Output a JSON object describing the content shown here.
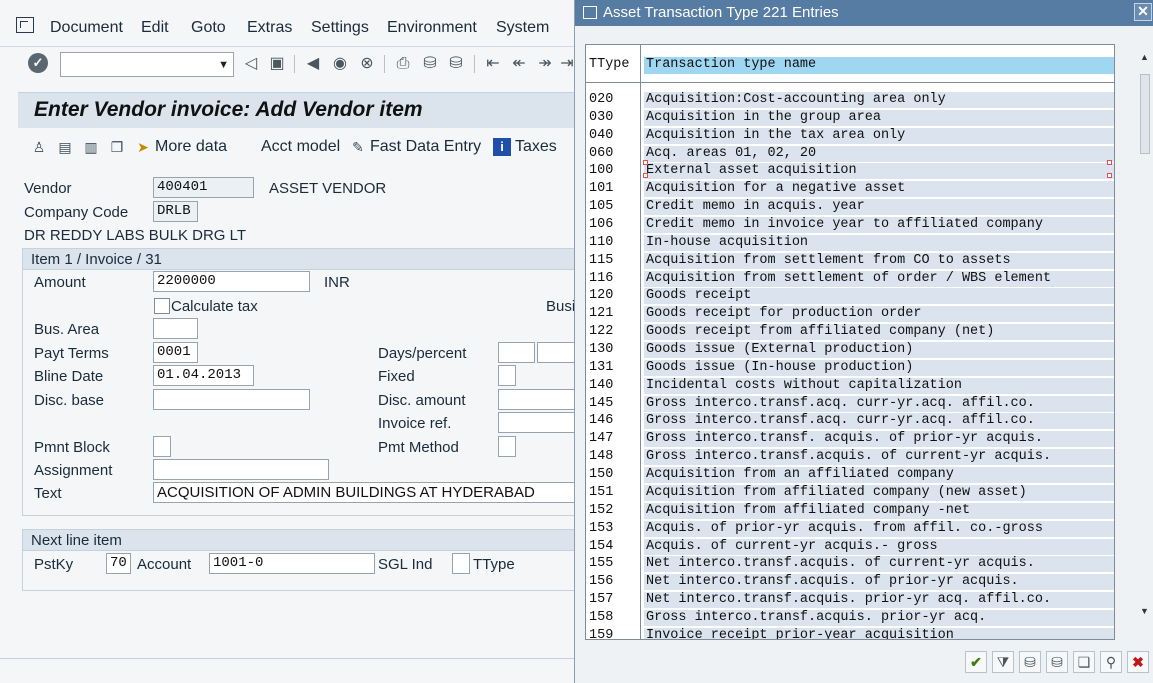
{
  "menu": {
    "items": [
      {
        "label": "Document"
      },
      {
        "label": "Edit"
      },
      {
        "label": "Goto"
      },
      {
        "label": "Extras"
      },
      {
        "label": "Settings"
      },
      {
        "label": "Environment"
      },
      {
        "label": "System"
      }
    ]
  },
  "screen": {
    "title": "Enter Vendor invoice: Add Vendor item"
  },
  "app_toolbar": {
    "more_data": "More data",
    "acct_model": "Acct model",
    "fast_data_entry": "Fast Data Entry",
    "taxes": "Taxes"
  },
  "header_fields": {
    "vendor_label": "Vendor",
    "vendor_value": "400401",
    "vendor_name": "ASSET VENDOR",
    "company_code_label": "Company Code",
    "company_code_value": "DRLB",
    "company_name": "DR REDDY LABS BULK DRG LT"
  },
  "item": {
    "group_title": "Item 1 / Invoice / 31",
    "amount_label": "Amount",
    "amount_value": "2200000",
    "currency": "INR",
    "calc_tax_label": "Calculate tax",
    "bus_cut": "Busi",
    "bus_area_label": "Bus. Area",
    "payt_terms_label": "Payt Terms",
    "payt_terms_value": "0001",
    "days_percent_label": "Days/percent",
    "bline_date_label": "Bline Date",
    "bline_date_value": "01.04.2013",
    "fixed_label": "Fixed",
    "disc_base_label": "Disc. base",
    "disc_amount_label": "Disc. amount",
    "invoice_ref_label": "Invoice ref.",
    "pmnt_block_label": "Pmnt Block",
    "pmt_method_label": "Pmt Method",
    "assignment_label": "Assignment",
    "text_label": "Text",
    "text_value": "ACQUISITION OF ADMIN BUILDINGS  AT HYDERABAD"
  },
  "next_line": {
    "group_title": "Next line item",
    "pstky_label": "PstKy",
    "pstky_value": "70",
    "account_label": "Account",
    "account_value": "1001-0",
    "sgl_ind_label": "SGL Ind",
    "ttype_label": "TType"
  },
  "popup": {
    "title": "Asset Transaction Type 221 Entries",
    "col_key": "TType",
    "col_name": "Transaction type name",
    "rows": [
      {
        "k": "020",
        "v": "Acquisition:Cost-accounting area only"
      },
      {
        "k": "030",
        "v": "Acquisition in the group area"
      },
      {
        "k": "040",
        "v": "Acquisition in the tax area only"
      },
      {
        "k": "060",
        "v": "Acq. areas 01, 02, 20"
      },
      {
        "k": "100",
        "v": "External asset acquisition"
      },
      {
        "k": "101",
        "v": "Acquisition for a negative asset"
      },
      {
        "k": "105",
        "v": "Credit memo in acquis. year"
      },
      {
        "k": "106",
        "v": "Credit memo in invoice year to affiliated company"
      },
      {
        "k": "110",
        "v": "In-house acquisition"
      },
      {
        "k": "115",
        "v": "Acquisition from settlement from CO to assets"
      },
      {
        "k": "116",
        "v": "Acquisition from settlement of order / WBS element"
      },
      {
        "k": "120",
        "v": "Goods receipt"
      },
      {
        "k": "121",
        "v": "Goods receipt for production order"
      },
      {
        "k": "122",
        "v": "Goods receipt from affiliated company (net)"
      },
      {
        "k": "130",
        "v": "Goods issue (External production)"
      },
      {
        "k": "131",
        "v": "Goods issue (In-house production)"
      },
      {
        "k": "140",
        "v": "Incidental costs without capitalization"
      },
      {
        "k": "145",
        "v": "Gross interco.transf.acq. curr-yr.acq. affil.co."
      },
      {
        "k": "146",
        "v": "Gross interco.transf.acq. curr-yr.acq. affil.co."
      },
      {
        "k": "147",
        "v": "Gross interco.transf. acquis. of prior-yr acquis."
      },
      {
        "k": "148",
        "v": "Gross interco.transf.acquis. of current-yr acquis."
      },
      {
        "k": "150",
        "v": "Acquisition from an affiliated company"
      },
      {
        "k": "151",
        "v": "Acquisition from affiliated company (new asset)"
      },
      {
        "k": "152",
        "v": "Acquisition from affiliated company -net"
      },
      {
        "k": "153",
        "v": "Acquis. of prior-yr acquis. from affil. co.-gross"
      },
      {
        "k": "154",
        "v": "Acquis. of current-yr acquis.- gross"
      },
      {
        "k": "155",
        "v": "Net interco.transf.acquis. of current-yr acquis."
      },
      {
        "k": "156",
        "v": "Net interco.transf.acquis. of prior-yr acquis."
      },
      {
        "k": "157",
        "v": "Net interco.transf.acquis. prior-yr acq. affil.co."
      },
      {
        "k": "158",
        "v": "Gross interco.transf.acquis. prior-yr acq."
      },
      {
        "k": "159",
        "v": "Invoice receipt prior-year acquisition"
      }
    ]
  }
}
